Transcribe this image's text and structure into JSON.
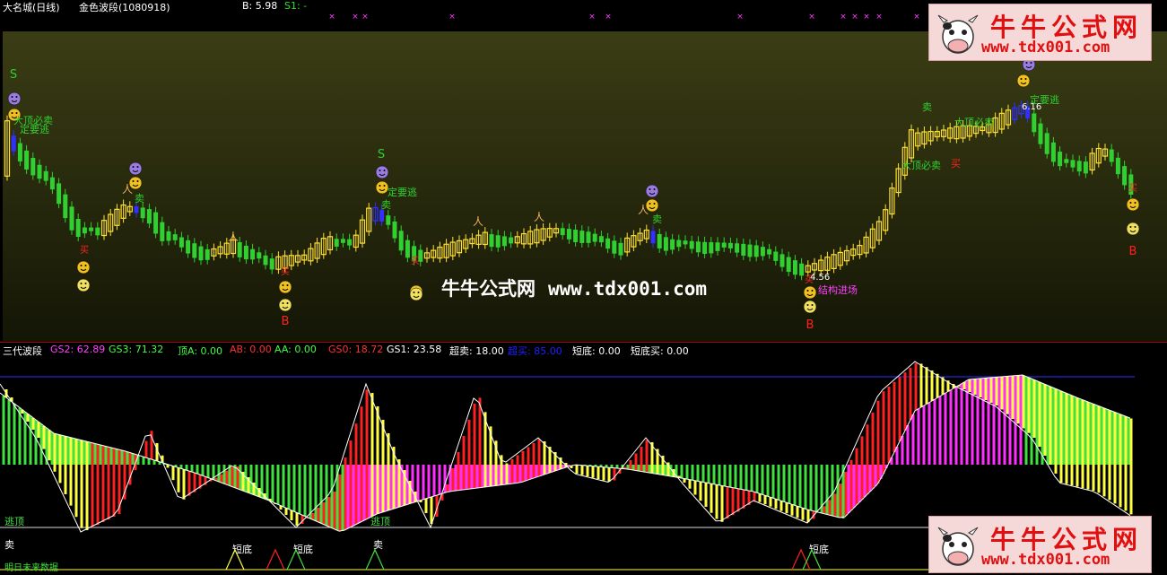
{
  "top": {
    "stock": "大名城(日线)",
    "indicator": "金色波段(1080918)",
    "b_value": "B: 5.98",
    "s1_value": "S1: -"
  },
  "watermark": {
    "site": "牛牛公式网",
    "url": "www.tdx001.com"
  },
  "logo": {
    "site": "牛牛公式网",
    "url": "www.tdx001.com"
  },
  "main_labels": {
    "s": "S",
    "b": "B",
    "sell": "卖",
    "buy": "买",
    "top_sell": "大顶必卖",
    "must_escape": "定要逃",
    "structure_entry": "结构进场",
    "price_low": "4.56",
    "price_high": "6.16"
  },
  "indicator": {
    "name": "三代波段",
    "values": [
      {
        "text": "GS2: 62.89",
        "color": "#ff40ff"
      },
      {
        "text": "GS3: 71.32",
        "color": "#40ff40"
      },
      {
        "text": "顶A: 0.00",
        "color": "#40ff40"
      },
      {
        "text": "AB: 0.00",
        "color": "#ff3030"
      },
      {
        "text": "AA: 0.00",
        "color": "#40ff40"
      },
      {
        "text": "GS0: 18.72",
        "color": "#ff3030"
      },
      {
        "text": "GS1: 23.58",
        "color": "#ffffff"
      },
      {
        "text": "超卖: 18.00",
        "color": "#ffffff"
      },
      {
        "text": "超买: 85.00",
        "color": "#2020ff"
      },
      {
        "text": "短底: 0.00",
        "color": "#ffffff"
      },
      {
        "text": "短底买: 0.00",
        "color": "#ffffff"
      }
    ],
    "labels": {
      "escape_top": "逃顶",
      "sell": "卖",
      "short_bottom": "短底",
      "footer": "明日未来数据"
    }
  },
  "colors": {
    "bull": "#ffe030",
    "bear": "#30d030",
    "red": "#ff2020",
    "magenta": "#ff30ff",
    "blue": "#3030ff",
    "yellow": "#ffff40"
  }
}
